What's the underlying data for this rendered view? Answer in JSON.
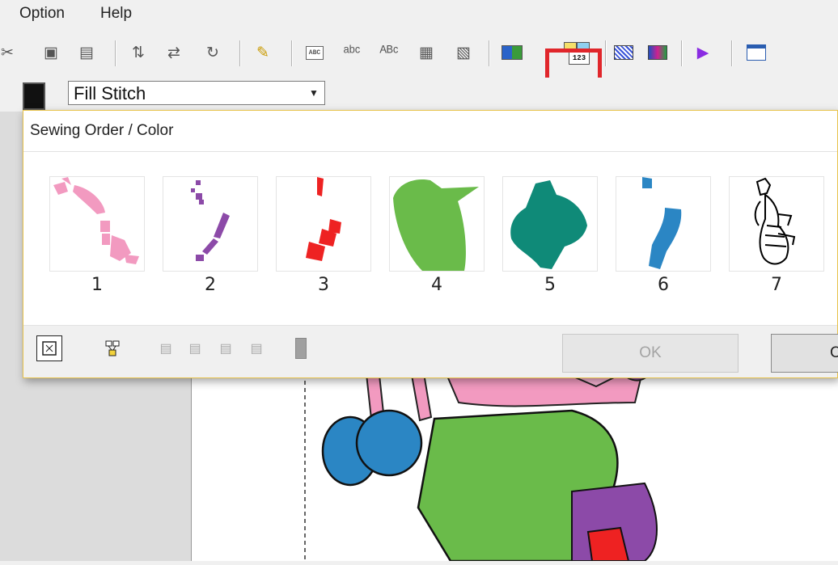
{
  "menu": {
    "items": [
      "Option",
      "Help"
    ]
  },
  "toolbar": {
    "buttons": [
      "cut-icon",
      "copy-icon",
      "paste-icon",
      "rotate-text-icon",
      "flip-icon",
      "rotate-icon",
      "magic-wand-icon",
      "text-abc-icon",
      "text-arc-icon",
      "text-vertical-icon",
      "text-frame-icon",
      "text-on-path-icon",
      "thread-chart-icon",
      "sewing-order-icon",
      "display-mode-icon",
      "realistic-view-icon",
      "stitch-simulator-icon",
      "design-property-icon"
    ],
    "highlighted": "sewing-order-icon",
    "abc": "ABC",
    "num123": "123"
  },
  "properties": {
    "stitch_type": "Fill Stitch"
  },
  "dialog": {
    "title": "Sewing Order / Color",
    "items": [
      {
        "number": "1",
        "color": "#f29ac0"
      },
      {
        "number": "2",
        "color": "#8c4aa8"
      },
      {
        "number": "3",
        "color": "#ee2222"
      },
      {
        "number": "4",
        "color": "#6abb4a"
      },
      {
        "number": "5",
        "color": "#0f8a78"
      },
      {
        "number": "6",
        "color": "#2b86c4"
      },
      {
        "number": "7",
        "color": "#000000"
      }
    ],
    "ok_label": "OK",
    "cancel_label": "C"
  }
}
